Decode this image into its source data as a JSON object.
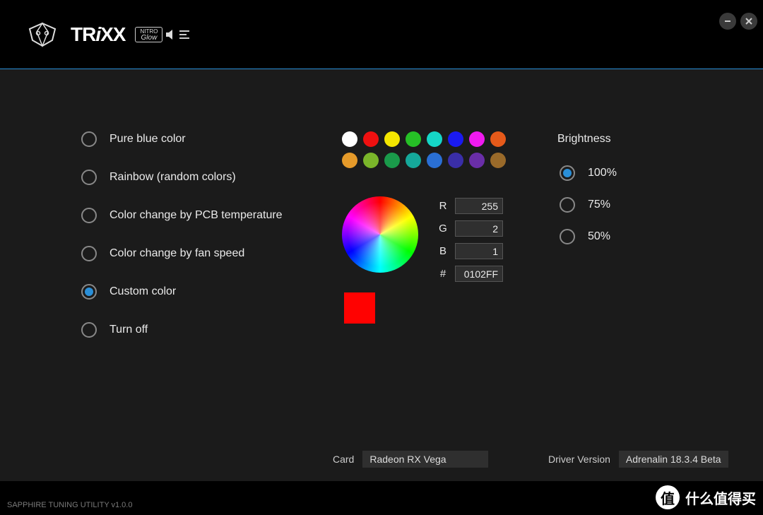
{
  "header": {
    "brand": "TRiXX",
    "nitro_top": "NITRO",
    "nitro_bottom": "Glow"
  },
  "modes": [
    {
      "id": "pure-blue",
      "label": "Pure blue color",
      "selected": false
    },
    {
      "id": "rainbow",
      "label": "Rainbow (random colors)",
      "selected": false
    },
    {
      "id": "pcb-temp",
      "label": "Color change by PCB temperature",
      "selected": false
    },
    {
      "id": "fan-speed",
      "label": "Color change by fan speed",
      "selected": false
    },
    {
      "id": "custom",
      "label": "Custom color",
      "selected": true
    },
    {
      "id": "off",
      "label": "Turn off",
      "selected": false
    }
  ],
  "swatches_row1": [
    "#ffffff",
    "#ef1010",
    "#f4e600",
    "#26c026",
    "#15d6c7",
    "#1a1af0",
    "#ef1aef",
    "#e65a1a"
  ],
  "swatches_row2": [
    "#e59a2a",
    "#7ab52a",
    "#1a9a4a",
    "#15a89a",
    "#2a6fd4",
    "#3a2ea8",
    "#6a2ea8",
    "#9a6a2a"
  ],
  "color": {
    "r_label": "R",
    "g_label": "G",
    "b_label": "B",
    "hex_label": "#",
    "r": "255",
    "g": "2",
    "b": "1",
    "hex": "0102FF",
    "preview": "#ff0201"
  },
  "brightness": {
    "title": "Brightness",
    "options": [
      {
        "label": "100%",
        "selected": true
      },
      {
        "label": "75%",
        "selected": false
      },
      {
        "label": "50%",
        "selected": false
      }
    ]
  },
  "footer": {
    "card_label": "Card",
    "card_value": "Radeon RX Vega",
    "driver_label": "Driver Version",
    "driver_value": "Adrenalin 18.3.4 Beta"
  },
  "statusbar": {
    "version": "SAPPHIRE TUNING UTILITY v1.0.0",
    "watermark_char": "值",
    "watermark_text": "什么值得买"
  }
}
